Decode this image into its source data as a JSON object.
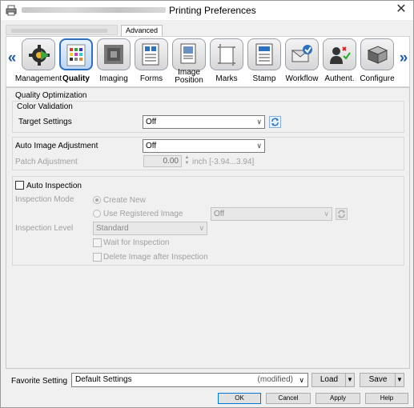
{
  "window": {
    "title": "Printing Preferences",
    "close_label": "✕"
  },
  "tabs": {
    "advanced": "Advanced"
  },
  "nav": {
    "left": "«",
    "right": "»"
  },
  "toolbar": {
    "items": [
      {
        "label": "Management",
        "icon": "management-icon"
      },
      {
        "label": "Quality",
        "icon": "quality-icon",
        "active": true
      },
      {
        "label": "Imaging",
        "icon": "imaging-icon"
      },
      {
        "label": "Forms",
        "icon": "forms-icon"
      },
      {
        "label": "Image Position",
        "label_line1": "Image",
        "label_line2": "Position",
        "icon": "image-position-icon"
      },
      {
        "label": "Marks",
        "icon": "marks-icon"
      },
      {
        "label": "Stamp",
        "icon": "stamp-icon"
      },
      {
        "label": "Workflow",
        "icon": "workflow-icon"
      },
      {
        "label": "Authent.",
        "icon": "authentication-icon"
      },
      {
        "label": "Configure",
        "icon": "configure-icon"
      }
    ]
  },
  "quality": {
    "section_title": "Quality Optimization",
    "color_validation": {
      "title": "Color Validation",
      "target_settings_label": "Target Settings",
      "target_settings_value": "Off"
    },
    "auto_image_adjustment_label": "Auto Image Adjustment",
    "auto_image_adjustment_value": "Off",
    "patch_adjustment_label": "Patch Adjustment",
    "patch_adjustment_value": "0.00",
    "patch_adjustment_unit": "inch [-3.94...3.94]",
    "auto_inspection_label": "Auto Inspection",
    "inspection_mode_label": "Inspection Mode",
    "create_new_label": "Create New",
    "use_registered_label": "Use Registered Image",
    "registered_image_value": "Off",
    "inspection_level_label": "Inspection Level",
    "inspection_level_value": "Standard",
    "wait_for_inspection_label": "Wait for Inspection",
    "delete_image_label": "Delete Image after Inspection"
  },
  "favorite": {
    "label": "Favorite Setting",
    "value": "Default Settings",
    "modified": "(modified)",
    "load_label": "Load",
    "save_label": "Save"
  },
  "buttons": {
    "ok": "OK",
    "cancel": "Cancel",
    "apply": "Apply",
    "help": "Help"
  },
  "colors": {
    "accent": "#2f6fc0",
    "nav_arrow": "#1f5fa8"
  }
}
